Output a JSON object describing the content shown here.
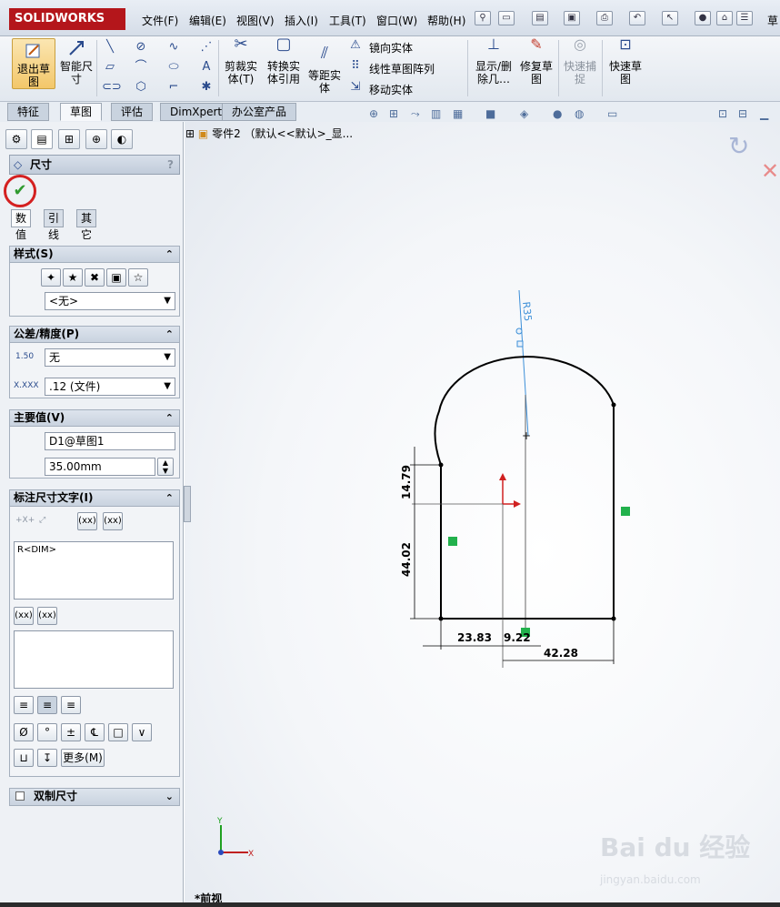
{
  "app": {
    "logo": "SOLIDWORKS"
  },
  "menu": [
    "文件(F)",
    "编辑(E)",
    "视图(V)",
    "插入(I)",
    "工具(T)",
    "窗口(W)",
    "帮助(H)",
    "草"
  ],
  "command_manager": {
    "exit_sketch": "退出草图",
    "smart_dimension": "智能尺寸",
    "trim": "剪裁实体(T)",
    "convert": "转换实体引用",
    "offset": "等距实体",
    "mirror": "镜向实体",
    "linear_pattern": "线性草图阵列",
    "move": "移动实体",
    "show_delete": "显示/删除几…",
    "repair": "修复草图",
    "quick_snap": "快速捕捉",
    "rapid_sketch": "快速草图"
  },
  "tabs": [
    "特征",
    "草图",
    "评估",
    "DimXpert",
    "办公室产品"
  ],
  "feature_tree": {
    "item": "零件2 （默认<<默认>_显..."
  },
  "property_manager": {
    "title": "尺寸",
    "help": "?",
    "ok_icon": "checkmark-icon",
    "subtabs": [
      "数值",
      "引线",
      "其它"
    ],
    "style": {
      "header": "样式(S)",
      "select": "<无>"
    },
    "tolerance": {
      "header": "公差/精度(P)",
      "tol_icon_text": "1.50",
      "tol_select": "无",
      "prec_icon_text": "X.XXX",
      "prec_select": ".12 (文件)"
    },
    "primary_value": {
      "header": "主要值(V)",
      "name": "D1@草图1",
      "value": "35.00mm"
    },
    "dim_text": {
      "header": "标注尺寸文字(I)",
      "xx_a": "(xx)",
      "xx_b": "(xx)",
      "text": "R<DIM>",
      "xx_c": "(xx)",
      "xx_d": "(xx)",
      "symbols": [
        "Ø",
        "°",
        "±",
        "℄",
        "□",
        "∨",
        "⊔",
        "↧"
      ],
      "more": "更多(M)"
    },
    "dual": {
      "header": "双制尺寸"
    }
  },
  "drawing": {
    "radius_label": "R35",
    "dims": [
      "14.79",
      "44.02",
      "23.83",
      "9.22",
      "42.28"
    ],
    "axis_x": "X",
    "axis_y": "Y",
    "view_name": "*前视"
  },
  "watermark": {
    "main": "Bai du 经验",
    "sub": "jingyan.baidu.com"
  },
  "colors": {
    "accent": "#b4161b",
    "ok": "#2f9a2f",
    "sketch_line": "#000000",
    "dim_line": "#3d8fd8"
  }
}
